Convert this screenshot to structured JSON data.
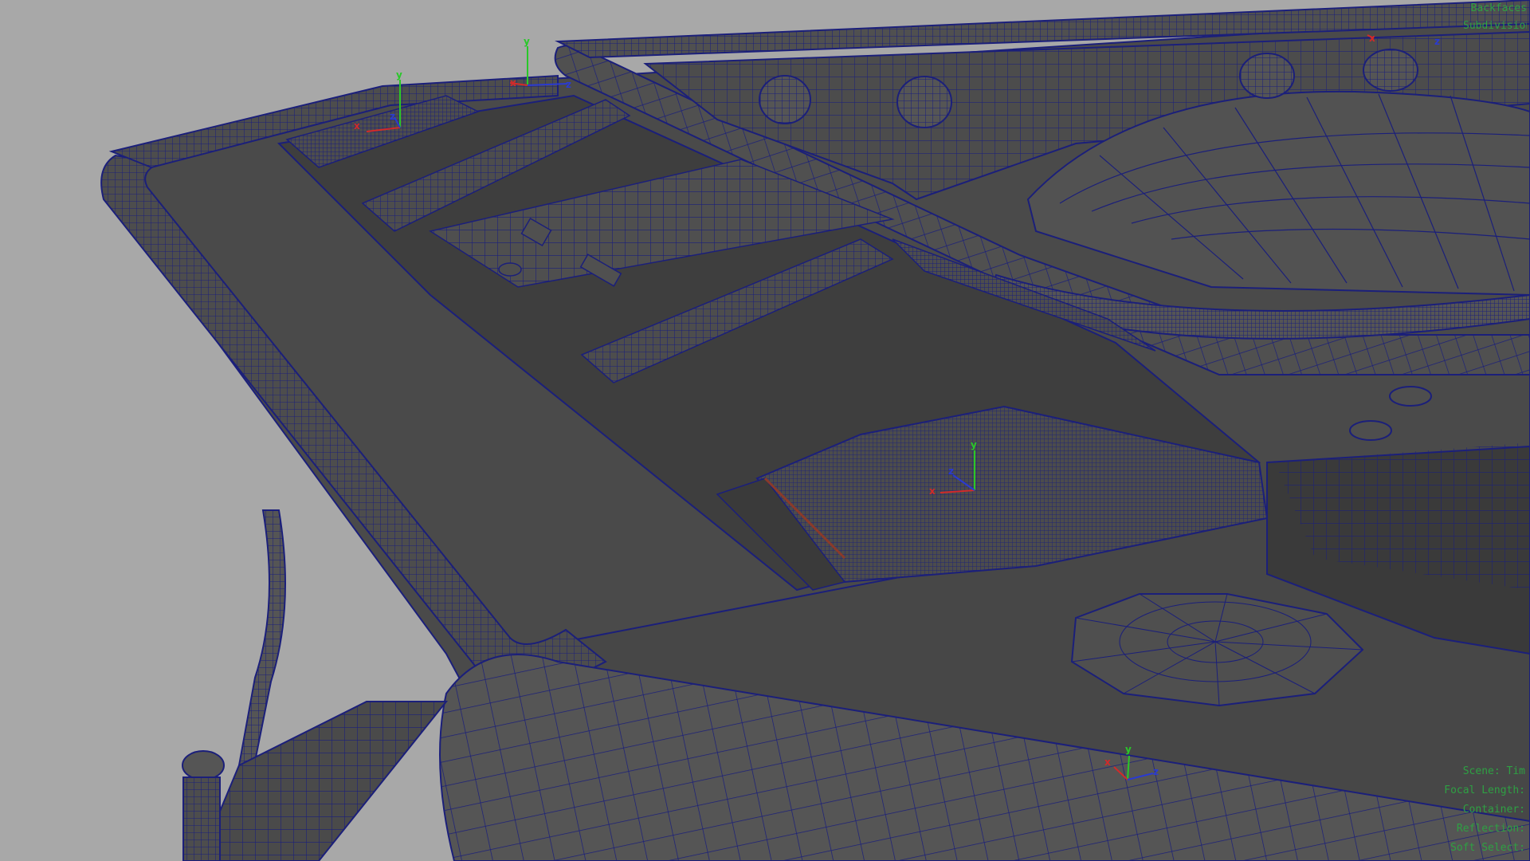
{
  "viewport": {
    "background": "#a8a8a8",
    "mesh_fill": "#4a4a4a",
    "mesh_dark": "#3b3b3b",
    "wire_color": "#1b1f7a"
  },
  "axes": {
    "x_label": "x",
    "y_label": "y",
    "z_label": "z",
    "x_color": "#d22a2a",
    "y_color": "#29c829",
    "z_color": "#2a3ad2"
  },
  "hud": {
    "top_lines": [
      "Backfaces",
      "Subdivision"
    ],
    "bottom_lines": [
      "Scene: Tim",
      "Focal Length:",
      "Container:",
      "Reflection:",
      "Soft Select:"
    ],
    "color": "#2ea043"
  }
}
